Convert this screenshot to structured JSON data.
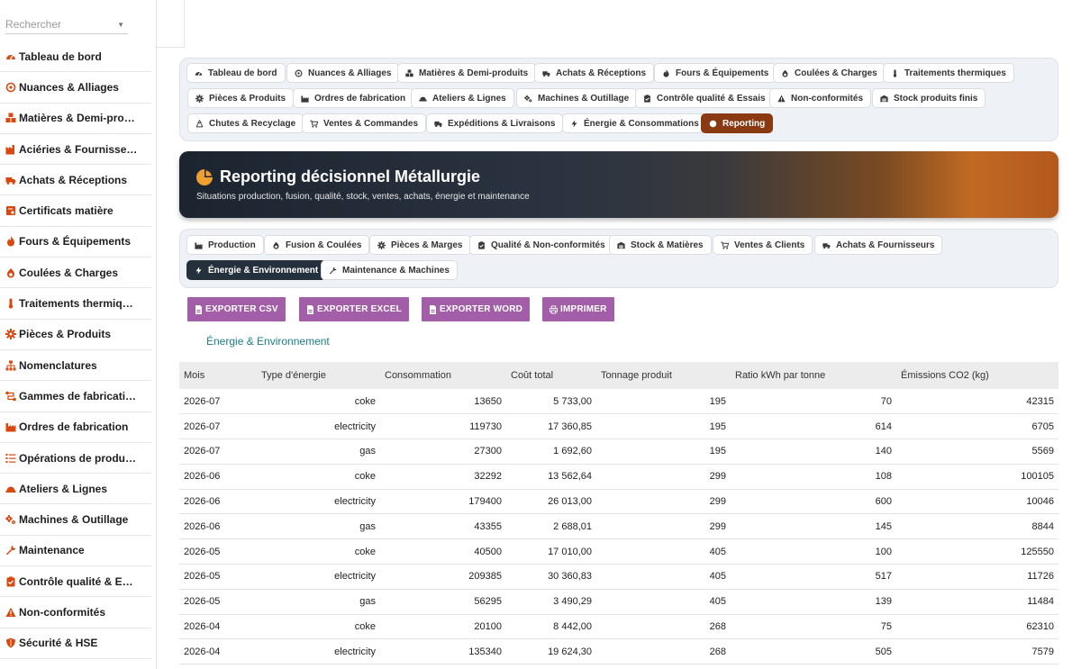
{
  "search": {
    "placeholder": "Rechercher"
  },
  "sidebar": {
    "items": [
      {
        "label": "Tableau de bord",
        "icon": "gauge-icon"
      },
      {
        "label": "Nuances & Alliages",
        "icon": "atom-icon"
      },
      {
        "label": "Matières & Demi-pro…",
        "icon": "cubes-icon"
      },
      {
        "label": "Aciéries & Fournisse…",
        "icon": "factory-icon"
      },
      {
        "label": "Achats & Réceptions",
        "icon": "truck-icon"
      },
      {
        "label": "Certificats matière",
        "icon": "certificate-icon"
      },
      {
        "label": "Fours & Équipements",
        "icon": "fire-icon"
      },
      {
        "label": "Coulées & Charges",
        "icon": "flame-icon"
      },
      {
        "label": "Traitements thermiq…",
        "icon": "thermometer-icon"
      },
      {
        "label": "Pièces & Produits",
        "icon": "gear-icon"
      },
      {
        "label": "Nomenclatures",
        "icon": "sitemap-icon"
      },
      {
        "label": "Gammes de fabricati…",
        "icon": "route-icon"
      },
      {
        "label": "Ordres de fabrication",
        "icon": "industry-icon"
      },
      {
        "label": "Opérations de produ…",
        "icon": "list-icon"
      },
      {
        "label": "Ateliers & Lignes",
        "icon": "helmet-icon"
      },
      {
        "label": "Machines & Outillage",
        "icon": "cogs-icon"
      },
      {
        "label": "Maintenance",
        "icon": "wrench-icon"
      },
      {
        "label": "Contrôle qualité & E…",
        "icon": "clipboard-check-icon"
      },
      {
        "label": "Non-conformités",
        "icon": "warning-icon"
      },
      {
        "label": "Sécurité & HSE",
        "icon": "shield-icon"
      }
    ]
  },
  "nav": {
    "tabs": [
      {
        "label": "Tableau de bord",
        "icon": "gauge-icon"
      },
      {
        "label": "Nuances & Alliages",
        "icon": "atom-icon"
      },
      {
        "label": "Matières & Demi-produits",
        "icon": "cubes-icon"
      },
      {
        "label": "Achats & Réceptions",
        "icon": "truck-icon"
      },
      {
        "label": "Fours & Équipements",
        "icon": "fire-icon"
      },
      {
        "label": "Coulées & Charges",
        "icon": "flame-icon"
      },
      {
        "label": "Traitements thermiques",
        "icon": "thermometer-icon"
      },
      {
        "label": "Pièces & Produits",
        "icon": "gear-icon"
      },
      {
        "label": "Ordres de fabrication",
        "icon": "industry-icon"
      },
      {
        "label": "Ateliers & Lignes",
        "icon": "helmet-icon"
      },
      {
        "label": "Machines & Outillage",
        "icon": "cogs-icon"
      },
      {
        "label": "Contrôle qualité & Essais",
        "icon": "clipboard-check-icon"
      },
      {
        "label": "Non-conformités",
        "icon": "warning-icon"
      },
      {
        "label": "Stock produits finis",
        "icon": "warehouse-icon"
      },
      {
        "label": "Chutes & Recyclage",
        "icon": "recycle-icon"
      },
      {
        "label": "Ventes & Commandes",
        "icon": "cart-icon"
      },
      {
        "label": "Expéditions & Livraisons",
        "icon": "shipping-icon"
      },
      {
        "label": "Énergie & Consommations",
        "icon": "bolt-icon"
      },
      {
        "label": "Reporting",
        "icon": "pie-chart-icon",
        "active": true
      }
    ]
  },
  "banner": {
    "title": "Reporting décisionnel Métallurgie",
    "subtitle": "Situations production, fusion, qualité, stock, ventes, achats, énergie et maintenance",
    "icon": "pie-chart-icon"
  },
  "subnav": {
    "tabs": [
      {
        "label": "Production",
        "icon": "industry-icon"
      },
      {
        "label": "Fusion & Coulées",
        "icon": "flame-icon"
      },
      {
        "label": "Pièces & Marges",
        "icon": "gear-icon"
      },
      {
        "label": "Qualité & Non-conformités",
        "icon": "clipboard-check-icon"
      },
      {
        "label": "Stock & Matières",
        "icon": "warehouse-icon"
      },
      {
        "label": "Ventes & Clients",
        "icon": "cart-icon"
      },
      {
        "label": "Achats & Fournisseurs",
        "icon": "truck-icon"
      },
      {
        "label": "Énergie & Environnement",
        "icon": "bolt-icon",
        "active": true
      },
      {
        "label": "Maintenance & Machines",
        "icon": "wrench-icon"
      }
    ]
  },
  "exports": {
    "csv": "EXPORTER CSV",
    "excel": "EXPORTER EXCEL",
    "word": "EXPORTER WORD",
    "print": "IMPRIMER"
  },
  "section": {
    "title": "Énergie & Environnement"
  },
  "table": {
    "columns": [
      "Mois",
      "Type d'énergie",
      "Consommation",
      "Coût total",
      "Tonnage produit",
      "Ratio kWh par tonne",
      "Émissions CO2 (kg)"
    ],
    "rows": [
      [
        "2026-07",
        "coke",
        "13650",
        "5 733,00",
        "195",
        "70",
        "42315"
      ],
      [
        "2026-07",
        "electricity",
        "119730",
        "17 360,85",
        "195",
        "614",
        "6705"
      ],
      [
        "2026-07",
        "gas",
        "27300",
        "1 692,60",
        "195",
        "140",
        "5569"
      ],
      [
        "2026-06",
        "coke",
        "32292",
        "13 562,64",
        "299",
        "108",
        "100105"
      ],
      [
        "2026-06",
        "electricity",
        "179400",
        "26 013,00",
        "299",
        "600",
        "10046"
      ],
      [
        "2026-06",
        "gas",
        "43355",
        "2 688,01",
        "299",
        "145",
        "8844"
      ],
      [
        "2026-05",
        "coke",
        "40500",
        "17 010,00",
        "405",
        "100",
        "125550"
      ],
      [
        "2026-05",
        "electricity",
        "209385",
        "30 360,83",
        "405",
        "517",
        "11726"
      ],
      [
        "2026-05",
        "gas",
        "56295",
        "3 490,29",
        "405",
        "139",
        "11484"
      ],
      [
        "2026-04",
        "coke",
        "20100",
        "8 442,00",
        "268",
        "75",
        "62310"
      ],
      [
        "2026-04",
        "electricity",
        "135340",
        "19 624,30",
        "268",
        "505",
        "7579"
      ]
    ]
  },
  "colors": {
    "accent_icon": "#d9480f",
    "active_tab": "#8a3a12",
    "active_subtab": "#25303d",
    "export_button": "#a25ea6",
    "section_title": "#1b7f86"
  }
}
